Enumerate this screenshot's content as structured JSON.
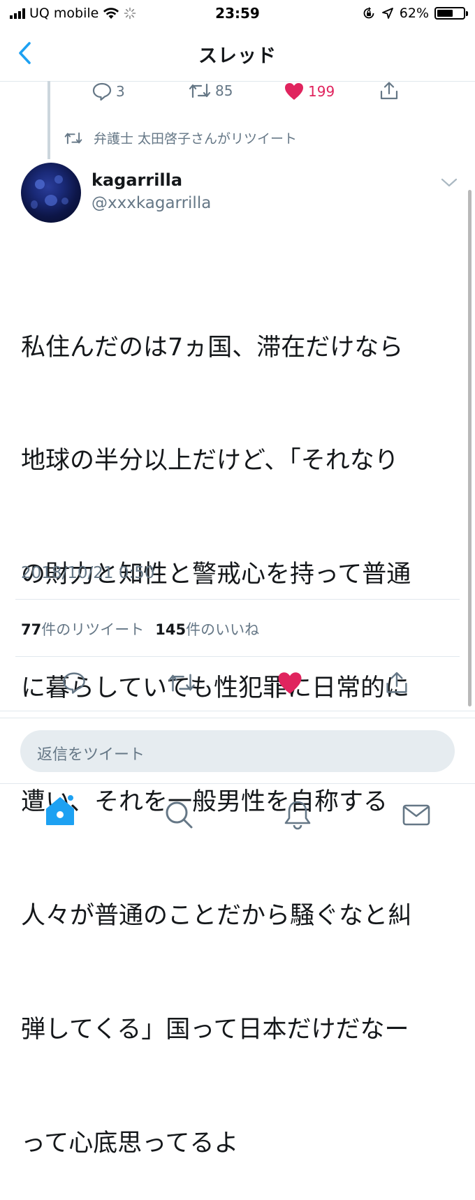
{
  "status_bar": {
    "carrier": "UQ mobile",
    "time": "23:59",
    "battery": "62%",
    "battery_level": 0.62
  },
  "nav": {
    "title": "スレッド"
  },
  "previous_tweet": {
    "reply_count": "3",
    "retweet_count": "85",
    "like_count": "199"
  },
  "retweet_label": "弁護士 太田啓子さんがリツイート",
  "tweet": {
    "name": "kagarrilla",
    "handle": "@xxxkagarrilla",
    "text_lines": [
      "私住んだのは7ヵ国、滞在だけなら",
      "地球の半分以上だけど、「それなり",
      "の財力と知性と警戒心を持って普通",
      "に暮らしていても性犯罪に日常的に",
      "遭い、それを一般男性を自称する",
      "人々が普通のことだから騒ぐなと糾",
      "弾してくる」国って日本だけだなー",
      "って心底思ってるよ"
    ],
    "timestamp": "2018/10/21 0:50",
    "retweets": "77",
    "retweets_label": "件のリツイート",
    "likes": "145",
    "likes_label": "件のいいね"
  },
  "reply": {
    "placeholder": "返信をツイート"
  },
  "colors": {
    "accent": "#1da1f2",
    "like": "#e0245e",
    "secondary_text": "#657786"
  }
}
